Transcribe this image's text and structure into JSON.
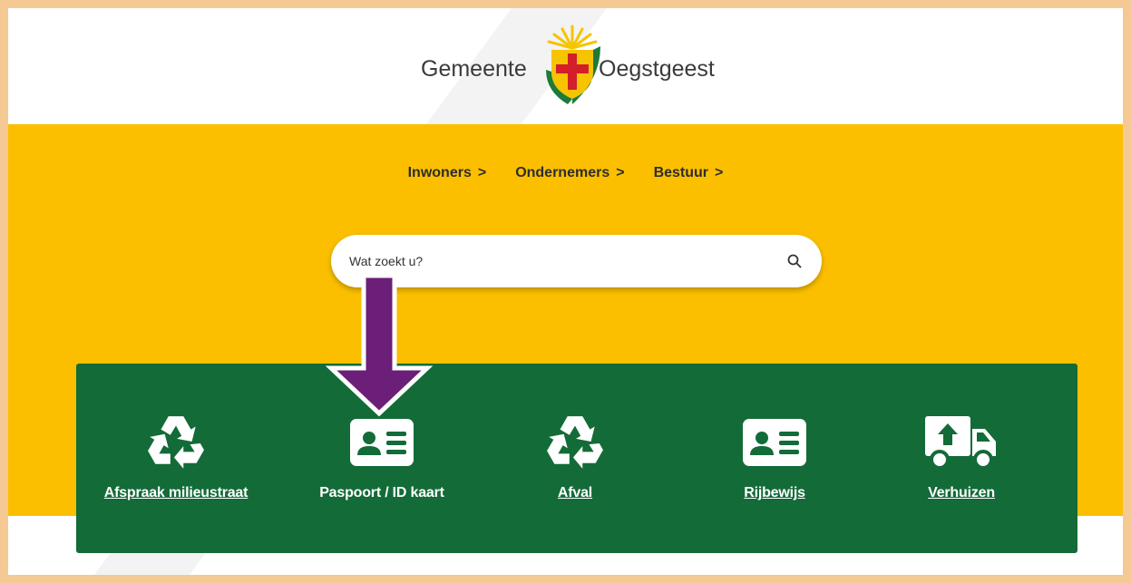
{
  "header": {
    "logo_left": "Gemeente",
    "logo_right": "Oegstgeest"
  },
  "nav": {
    "items": [
      {
        "label": "Inwoners",
        "chevron": ">"
      },
      {
        "label": "Ondernemers",
        "chevron": ">"
      },
      {
        "label": "Bestuur",
        "chevron": ">"
      }
    ]
  },
  "search": {
    "placeholder": "Wat zoekt u?",
    "icon": "search-icon"
  },
  "quick_links": [
    {
      "label": "Afspraak milieustraat",
      "icon": "recycle-icon",
      "underlined": true
    },
    {
      "label": "Paspoort / ID kaart",
      "icon": "id-card-icon",
      "underlined": false
    },
    {
      "label": "Afval",
      "icon": "recycle-icon",
      "underlined": true
    },
    {
      "label": "Rijbewijs",
      "icon": "id-card-icon",
      "underlined": true
    },
    {
      "label": "Verhuizen",
      "icon": "moving-truck-icon",
      "underlined": true
    }
  ],
  "annotation": {
    "icon": "down-arrow-icon",
    "color": "#6b1f78"
  },
  "colors": {
    "frame_border": "#f5c994",
    "brand_yellow": "#fbbf00",
    "brand_green": "#136b38"
  }
}
